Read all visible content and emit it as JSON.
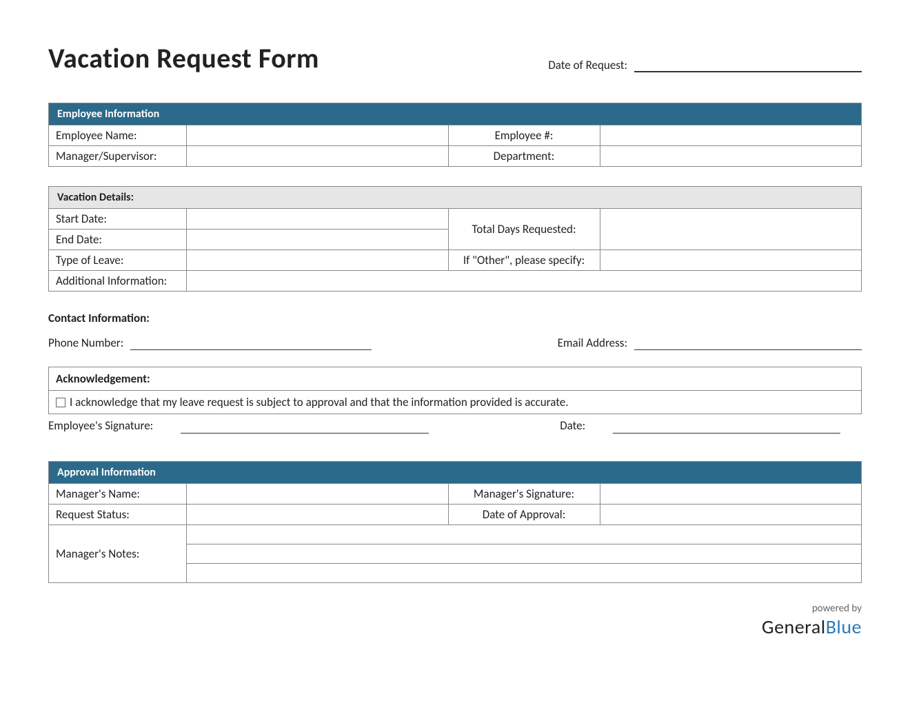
{
  "title": "Vacation Request Form",
  "date_request_label": "Date of Request:",
  "employee_info": {
    "header": "Employee Information",
    "name_label": "Employee Name:",
    "number_label": "Employee #:",
    "manager_label": "Manager/Supervisor:",
    "department_label": "Department:"
  },
  "vacation_details": {
    "header": "Vacation Details:",
    "start_label": "Start Date:",
    "end_label": "End Date:",
    "total_days_label": "Total Days Requested:",
    "type_label": "Type of Leave:",
    "other_label": "If \"Other\", please specify:",
    "additional_label": "Additional Information:"
  },
  "contact": {
    "header": "Contact Information:",
    "phone_label": "Phone Number:",
    "email_label": "Email Address:"
  },
  "acknowledgement": {
    "header": "Acknowledgement:",
    "text": "I acknowledge that my leave request is subject to approval and that the information provided is accurate.",
    "sig_label": "Employee's Signature:",
    "date_label": "Date:"
  },
  "approval": {
    "header": "Approval Information",
    "manager_name_label": "Manager's Name:",
    "manager_sig_label": "Manager's Signature:",
    "status_label": "Request Status:",
    "approval_date_label": "Date of Approval:",
    "notes_label": "Manager's Notes:"
  },
  "footer": {
    "powered": "powered by",
    "brand1": "General",
    "brand2": "Blue"
  }
}
